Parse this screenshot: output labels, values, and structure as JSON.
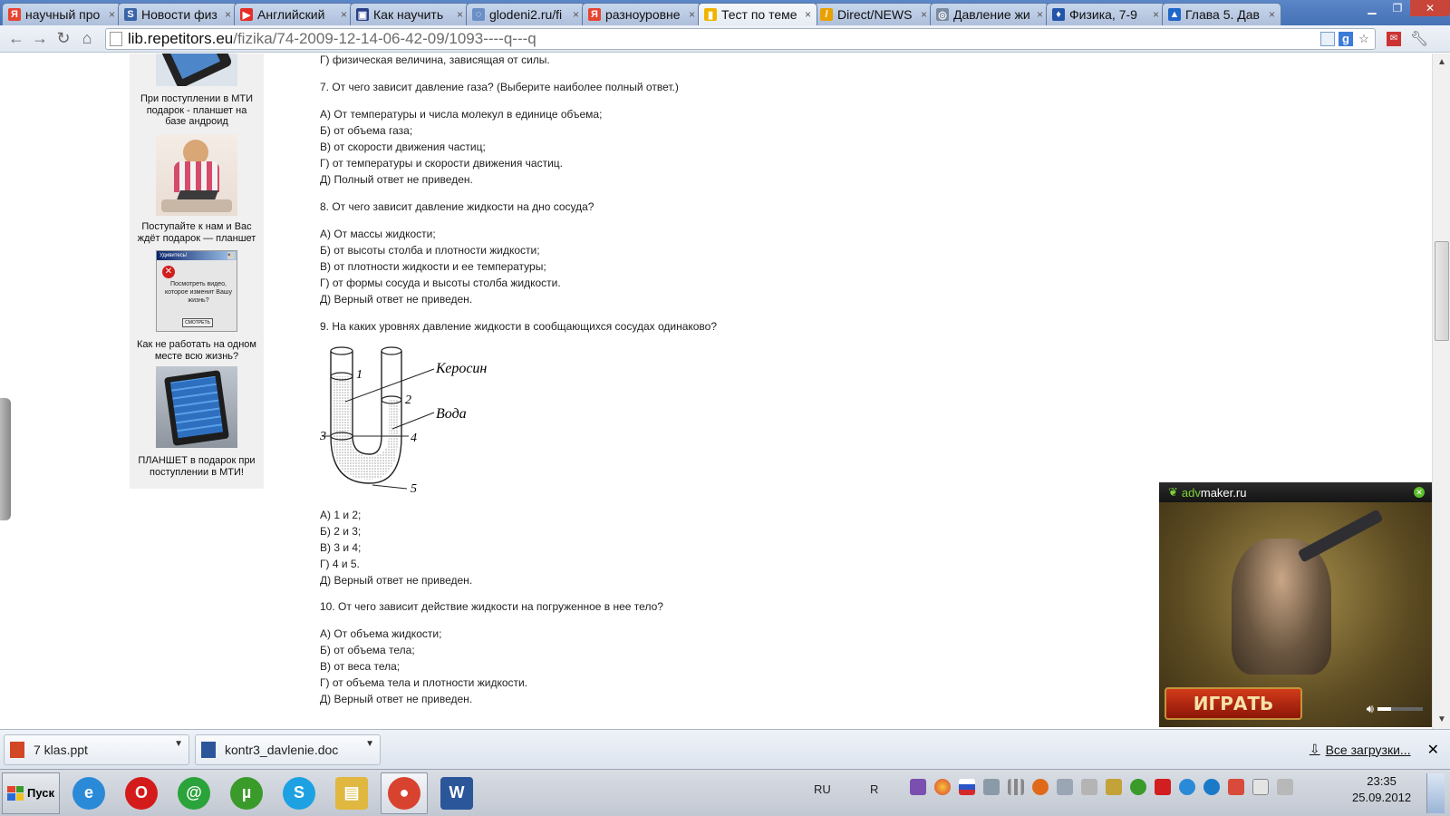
{
  "tabs": [
    {
      "label": "научный про",
      "fav_color": "#e8432f",
      "fav_glyph": "Я",
      "active": false
    },
    {
      "label": "Новости физ",
      "fav_color": "#3a64a8",
      "fav_glyph": "S",
      "active": false
    },
    {
      "label": "Английский",
      "fav_color": "#e52d27",
      "fav_glyph": "▶",
      "active": false
    },
    {
      "label": "Как научить",
      "fav_color": "#2a3f88",
      "fav_glyph": "▣",
      "active": false
    },
    {
      "label": "glodeni2.ru/fi",
      "fav_color": "#6a8fc7",
      "fav_glyph": "◌",
      "active": false
    },
    {
      "label": "разноуровне",
      "fav_color": "#e8432f",
      "fav_glyph": "Я",
      "active": false
    },
    {
      "label": "Тест по теме",
      "fav_color": "#f0b400",
      "fav_glyph": "▮",
      "active": true
    },
    {
      "label": "Direct/NEWS",
      "fav_color": "#e8a100",
      "fav_glyph": "/",
      "active": false
    },
    {
      "label": "Давление жи",
      "fav_color": "#7a8aa0",
      "fav_glyph": "◎",
      "active": false
    },
    {
      "label": "Физика, 7-9",
      "fav_color": "#2255aa",
      "fav_glyph": "♦",
      "active": false
    },
    {
      "label": "Глава 5. Дав",
      "fav_color": "#1e66c8",
      "fav_glyph": "▲",
      "active": false
    }
  ],
  "address": {
    "host": "lib.repetitors.eu",
    "path": "/fizika/74-2009-12-14-06-42-09/1093----q---q"
  },
  "sidebar_ads": [
    {
      "caption": "При поступлении в МТИ подарок - планшет на базе андроид"
    },
    {
      "caption": "Поступайте к нам и Вас ждёт подарок — планшет"
    },
    {
      "caption": "Как не работать на одном месте всю жизнь?",
      "popup_title": "Удивитесь!",
      "popup_text": "Посмотреть видео, которое изменит Вашу жизнь?",
      "popup_button": "СМОТРЕТЬ"
    },
    {
      "caption": "ПЛАНШЕТ в подарок при поступлении в МТИ!"
    }
  ],
  "content": {
    "top_line": "Г)  физическая величина, зависящая от силы.",
    "q7": "7. От чего зависит давление газа? (Выберите наиболее полный ответ.)",
    "q7_answers": [
      "А) От температуры и числа молекул в единице объема;",
      "Б) от объема газа;",
      "В) от скорости движения частиц;",
      "Г) от температуры и скорости движения частиц.",
      "Д) Полный ответ не приведен."
    ],
    "q8": "8. От чего зависит давление жидкости на дно сосуда?",
    "q8_answers": [
      "А) От массы жидкости;",
      "Б) от высоты столба и плотности жидкости;",
      "В) от плотности жидкости и ее температуры;",
      "Г) от формы сосуда и высоты столба жидкости.",
      "Д) Верный ответ не приведен."
    ],
    "q9": "9. На каких уровнях давление жидкости в сообщающихся сосудах одинаково?",
    "figure": {
      "label_kerosene": "Керосин",
      "label_water": "Вода",
      "n1": "1",
      "n2": "2",
      "n3": "3",
      "n4": "4",
      "n5": "5"
    },
    "q9_answers": [
      "А) 1 и 2;",
      "Б) 2 и 3;",
      "В) 3 и 4;",
      "Г) 4 и 5.",
      "Д) Верный ответ не приведен."
    ],
    "q10": "10. От чего зависит действие жидкости на погруженное в нее тело?",
    "q10_answers": [
      "А) От объема жидкости;",
      "Б) от объема тела;",
      "В) от веса тела;",
      "Г) от объема тела и плотности жидкости.",
      "Д) Верный ответ не приведен."
    ]
  },
  "video_ad": {
    "brand_prefix": "adv",
    "brand_suffix": "maker.ru",
    "play_label": "ИГРАТЬ"
  },
  "downloads": [
    {
      "name": "7 klas.ppt",
      "icon_color": "#d24726"
    },
    {
      "name": "kontr3_davlenie.doc",
      "icon_color": "#2b579a"
    }
  ],
  "downloads_all_label": "Все загрузки...",
  "taskbar": {
    "start_label": "Пуск",
    "apps": [
      {
        "name": "ie",
        "color": "#2a8ad8",
        "glyph": "e"
      },
      {
        "name": "opera",
        "color": "#d41b1b",
        "glyph": "O"
      },
      {
        "name": "mail-agent",
        "color": "#2aa33a",
        "glyph": "@"
      },
      {
        "name": "utorrent",
        "color": "#3a9a2a",
        "glyph": "µ"
      },
      {
        "name": "skype",
        "color": "#1da1e2",
        "glyph": "S"
      },
      {
        "name": "explorer",
        "color": "#e0b840",
        "glyph": "▤"
      },
      {
        "name": "chrome",
        "color": "#d8432f",
        "glyph": "●"
      },
      {
        "name": "word",
        "color": "#2b579a",
        "glyph": "W"
      }
    ],
    "lang": "RU",
    "lang_hint": "R",
    "time": "23:35",
    "date": "25.09.2012"
  }
}
